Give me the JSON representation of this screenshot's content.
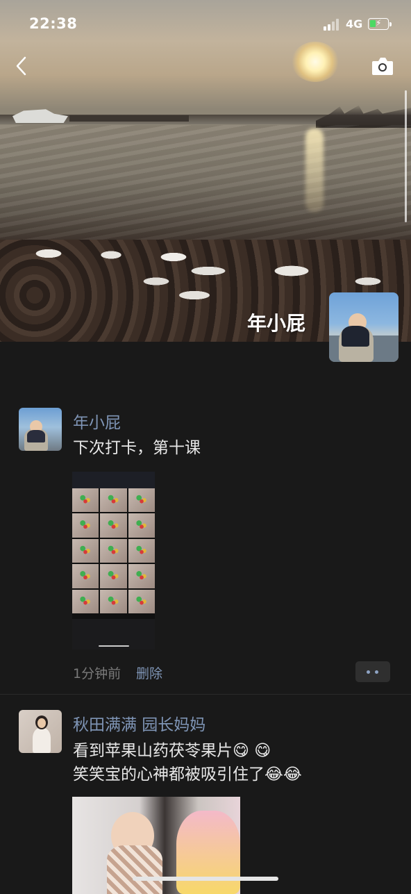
{
  "status_bar": {
    "time": "22:38",
    "network": "4G"
  },
  "nav": {
    "back_icon": "chevron-left-icon",
    "camera_icon": "camera-icon"
  },
  "profile": {
    "name": "年小屁"
  },
  "posts": [
    {
      "author": "年小屁",
      "text": "下次打卡，第十课",
      "time": "1分钟前",
      "delete_label": "删除"
    },
    {
      "author": "秋田满满 园长妈妈",
      "line1_text": "看到苹果山药茯苓果片",
      "line1_emojis": [
        "😋",
        "😋"
      ],
      "line2_text": "笑笑宝的心神都被吸引住了",
      "line2_emojis": [
        "😂",
        "😂"
      ]
    }
  ],
  "colors": {
    "background": "#191919",
    "link": "#7f95b6",
    "battery_level": "#4cd964"
  }
}
